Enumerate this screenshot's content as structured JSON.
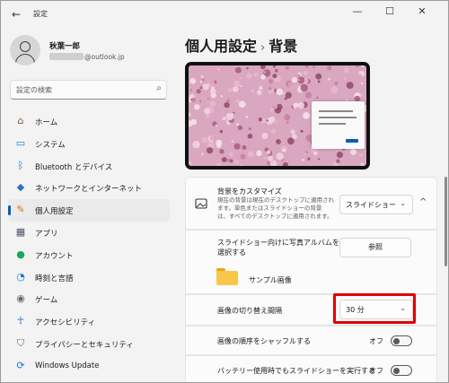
{
  "titlebar": {
    "back_icon": "←",
    "title": "設定",
    "minimize_icon": "—",
    "maximize_icon": "☐",
    "close_icon": "✕"
  },
  "user": {
    "name": "秋葉一郎",
    "email": "@outlook.jp"
  },
  "search": {
    "placeholder": "設定の検索",
    "icon": "⌕"
  },
  "nav": {
    "items": [
      {
        "label": "ホーム",
        "icon": "home-icon",
        "glyph": "⌂",
        "color": "#7a5a3a",
        "active": false
      },
      {
        "label": "システム",
        "icon": "display-icon",
        "glyph": "▭",
        "color": "#0b7fd1",
        "active": false
      },
      {
        "label": "Bluetooth とデバイス",
        "icon": "bluetooth-icon",
        "glyph": "ᛒ",
        "color": "#0b6fc7",
        "active": false
      },
      {
        "label": "ネットワークとインターネット",
        "icon": "wifi-icon",
        "glyph": "◆",
        "color": "#2b70c9",
        "active": false
      },
      {
        "label": "個人用設定",
        "icon": "brush-icon",
        "glyph": "✎",
        "color": "#c9770f",
        "active": true
      },
      {
        "label": "アプリ",
        "icon": "apps-icon",
        "glyph": "▦",
        "color": "#4a5564",
        "active": false
      },
      {
        "label": "アカウント",
        "icon": "account-icon",
        "glyph": "●",
        "color": "#20a55a",
        "active": false
      },
      {
        "label": "時刻と言語",
        "icon": "clock-globe-icon",
        "glyph": "◔",
        "color": "#1c75c8",
        "active": false
      },
      {
        "label": "ゲーム",
        "icon": "gamepad-icon",
        "glyph": "◉",
        "color": "#6b6b6b",
        "active": false
      },
      {
        "label": "アクセシビリティ",
        "icon": "accessibility-icon",
        "glyph": "☥",
        "color": "#1a6fd0",
        "active": false
      },
      {
        "label": "プライバシーとセキュリティ",
        "icon": "shield-icon",
        "glyph": "⛉",
        "color": "#5e6a78",
        "active": false
      },
      {
        "label": "Windows Update",
        "icon": "update-icon",
        "glyph": "⟳",
        "color": "#1b75d0",
        "active": false
      }
    ]
  },
  "page": {
    "breadcrumb_parent": "個人用設定",
    "breadcrumb_sep": "›",
    "title": "背景"
  },
  "background_card": {
    "title": "背景をカスタマイズ",
    "description": "現在の背景は現在のデスクトップに適用されます。単色またはスライドショーの背景は、すべてのデスクトップに適用されます。",
    "description_lines": [
      "現在の背景は現在のデスクトップに適用され",
      "ます。単色またはスライドショーの背景",
      "は、すべてのデスクトップに適用されます。"
    ],
    "dropdown_value": "スライドショー",
    "collapse_icon": "^"
  },
  "album_row": {
    "label_lines": [
      "スライドショー向けに写真アルバムを",
      "選択する"
    ],
    "browse_label": "参照",
    "folder_name": "サンプル画像"
  },
  "interval_row": {
    "label": "画像の切り替え間隔",
    "value": "30 分"
  },
  "shuffle_row": {
    "label": "画像の順序をシャッフルする",
    "state_label": "オフ",
    "on": false
  },
  "battery_row": {
    "label": "バッテリー使用時でもスライドショーを実行する",
    "state_label": "オフ",
    "on": false
  },
  "colors": {
    "accent": "#005fb8",
    "highlight": "#e00000",
    "blossom": "#d9a7bf"
  }
}
